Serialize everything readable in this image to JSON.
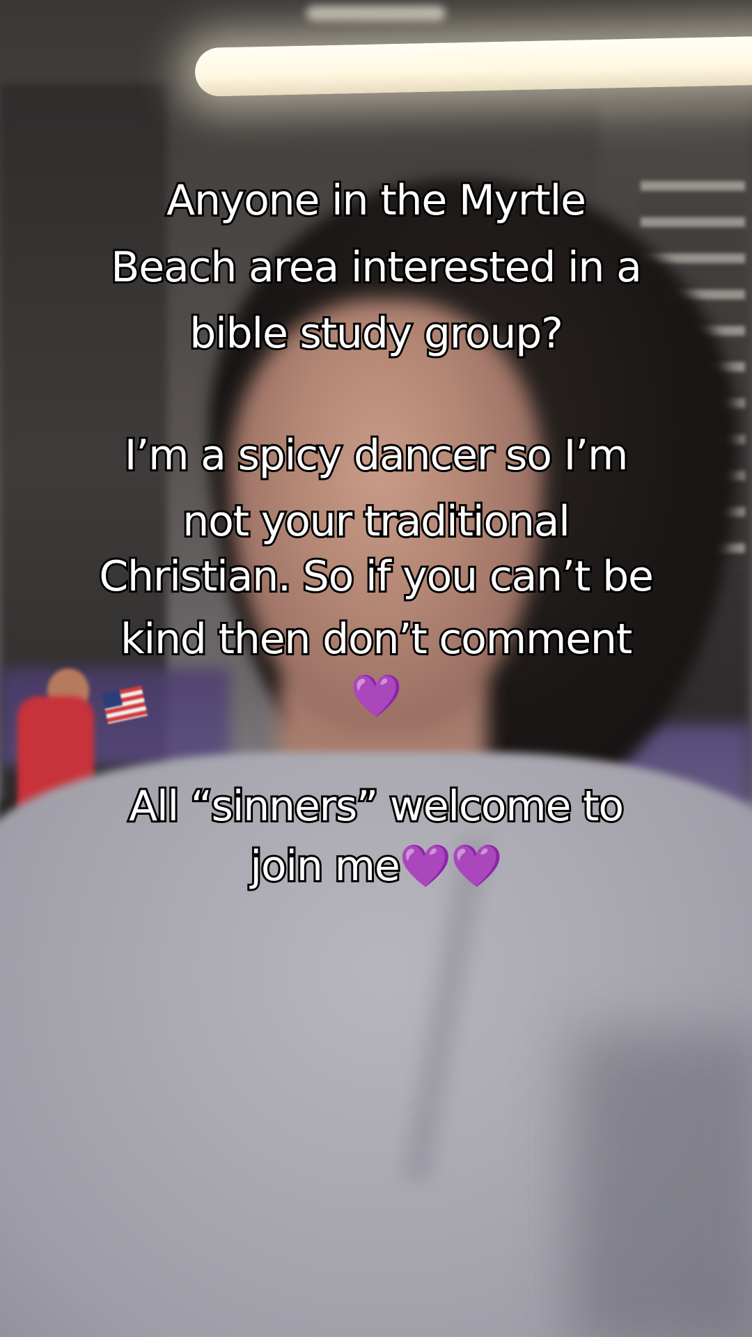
{
  "caption": {
    "paragraph_1": [
      "Anyone in the Myrtle",
      "Beach area interested in a",
      "bible study group?"
    ],
    "paragraph_2": [
      "I’m a spicy dancer so I’m",
      "not your traditional",
      "Christian. So if you can’t be",
      "kind then don’t comment"
    ],
    "heart_line": "💜",
    "paragraph_3": [
      "All “sinners” welcome to"
    ],
    "last_line_text": "join me",
    "last_line_hearts": "💜💜"
  },
  "colors": {
    "caption_text": "#ffffff",
    "caption_outline": "#000000",
    "heart": "#a24ae6"
  }
}
